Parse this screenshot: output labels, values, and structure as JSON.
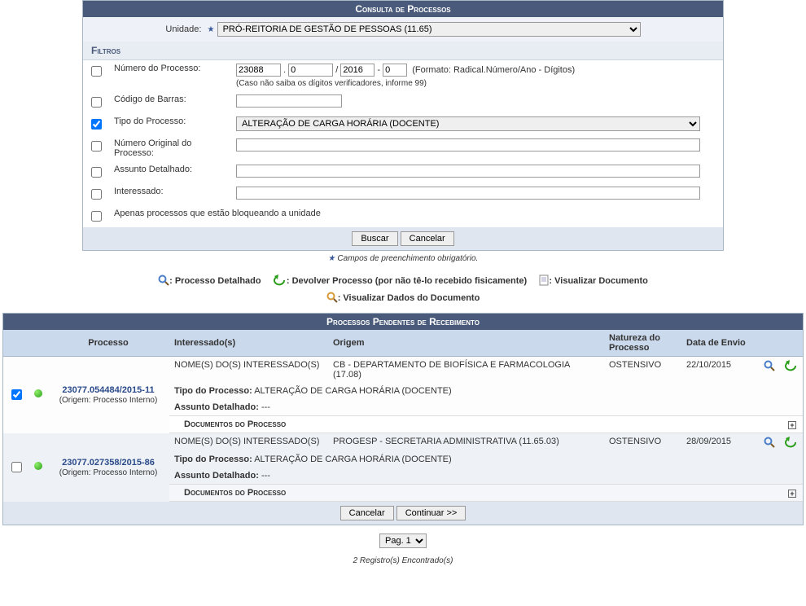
{
  "panel": {
    "title": "Consulta de Processos",
    "unidade_label": "Unidade:",
    "unidade_value": "PRÓ-REITORIA DE GESTÃO DE PESSOAS (11.65)"
  },
  "filters": {
    "title": "Filtros",
    "numero_processo_label": "Número do Processo:",
    "radical": "23088",
    "numero": "0",
    "ano": "2016",
    "digitos": "0",
    "formato_hint": "(Formato: Radical.Número/Ano - Dígitos)",
    "digitos_hint": "(Caso não saiba os dígitos verificadores, informe 99)",
    "codigo_barras_label": "Código de Barras:",
    "tipo_processo_label": "Tipo do Processo:",
    "tipo_processo_value": "ALTERAÇÃO DE CARGA HORÁRIA (DOCENTE)",
    "numero_original_label": "Número Original do Processo:",
    "assunto_detalhado_label": "Assunto Detalhado:",
    "interessado_label": "Interessado:",
    "apenas_bloqueando_label": "Apenas processos que estão bloqueando a unidade",
    "buscar": "Buscar",
    "cancelar": "Cancelar"
  },
  "mandatory_note": "Campos de preenchimento obrigatório.",
  "legend": {
    "processo_detalhado": ": Processo Detalhado",
    "devolver_processo": ": Devolver Processo (por não tê-lo recebido fisicamente)",
    "visualizar_documento": ": Visualizar Documento",
    "visualizar_dados": ": Visualizar Dados do Documento"
  },
  "pending": {
    "title": "Processos Pendentes de Recebimento",
    "headers": {
      "processo": "Processo",
      "interessados": "Interessado(s)",
      "origem": "Origem",
      "natureza": "Natureza do Processo",
      "data_envio": "Data de Envio"
    },
    "rows": [
      {
        "checked": true,
        "process_number": "23077.054484/2015-11",
        "origin_note": "(Origem: Processo Interno)",
        "interessado": "NOME(S) DO(S) INTERESSADO(S)",
        "origem": "CB - DEPARTAMENTO DE BIOFÍSICA E FARMACOLOGIA (17.08)",
        "natureza": "OSTENSIVO",
        "data_envio": "22/10/2015",
        "tipo_processo_label": "Tipo do Processo:",
        "tipo_processo_value": "ALTERAÇÃO DE CARGA HORÁRIA (DOCENTE)",
        "assunto_label": "Assunto Detalhado:",
        "assunto_value": "---",
        "docs_title": "Documentos do Processo"
      },
      {
        "checked": false,
        "process_number": "23077.027358/2015-86",
        "origin_note": "(Origem: Processo Interno)",
        "interessado": "NOME(S) DO(S) INTERESSADO(S)",
        "origem": "PROGESP - SECRETARIA ADMINISTRATIVA (11.65.03)",
        "natureza": "OSTENSIVO",
        "data_envio": "28/09/2015",
        "tipo_processo_label": "Tipo do Processo:",
        "tipo_processo_value": "ALTERAÇÃO DE CARGA HORÁRIA (DOCENTE)",
        "assunto_label": "Assunto Detalhado:",
        "assunto_value": "---",
        "docs_title": "Documentos do Processo"
      }
    ],
    "cancelar": "Cancelar",
    "continuar": "Continuar >>"
  },
  "pager": {
    "label": "Pag. 1"
  },
  "found": "2 Registro(s) Encontrado(s)"
}
